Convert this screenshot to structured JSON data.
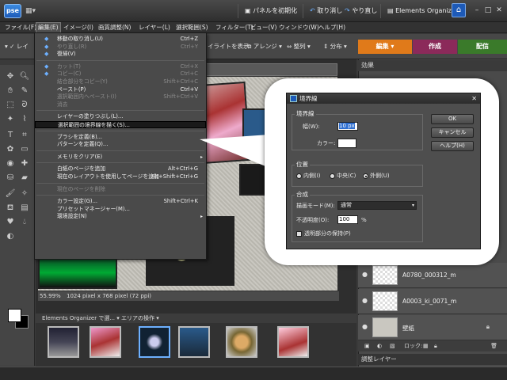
{
  "app": {
    "logo": "pse"
  },
  "titlebar": {
    "reset_panels": "パネルを初期化",
    "undo": "取り消し",
    "redo": "やり直し",
    "organizer": "Elements Organizer"
  },
  "menubar": [
    "ファイル(F)",
    "編集(E)",
    "イメージ(I)",
    "画質調整(N)",
    "レイヤー(L)",
    "選択範囲(S)",
    "フィルター(T)",
    "ビュー(V)",
    "ウィンドウ(W)",
    "ヘルプ(H)"
  ],
  "options": {
    "highlight": "イライトを表示",
    "arrange": "アレンジ",
    "align": "整列",
    "distribute": "分布",
    "layer_label": "レイ"
  },
  "mode_tabs": [
    {
      "label": "編集",
      "color": "#e07a1a"
    },
    {
      "label": "作成",
      "color": "#8b2a5a"
    },
    {
      "label": "配信",
      "color": "#3a7a2a"
    }
  ],
  "edit_menu": {
    "items": [
      {
        "label": "移動の取り消し(U)",
        "shortcut": "Ctrl+Z",
        "disabled": false,
        "icon": true
      },
      {
        "label": "やり直し(R)",
        "shortcut": "Ctrl+Y",
        "disabled": true,
        "icon": true
      },
      {
        "label": "復帰(V)",
        "shortcut": "",
        "disabled": false,
        "icon": true
      },
      {
        "sep": true
      },
      {
        "label": "カット(T)",
        "shortcut": "Ctrl+X",
        "disabled": true,
        "icon": true
      },
      {
        "label": "コピー(C)",
        "shortcut": "Ctrl+C",
        "disabled": true,
        "icon": true
      },
      {
        "label": "結合部分をコピー(Y)",
        "shortcut": "Shift+Ctrl+C",
        "disabled": true
      },
      {
        "label": "ペースト(P)",
        "shortcut": "Ctrl+V",
        "disabled": false
      },
      {
        "label": "選択範囲内へペースト(I)",
        "shortcut": "Shift+Ctrl+V",
        "disabled": true
      },
      {
        "label": "消去",
        "shortcut": "",
        "disabled": true
      },
      {
        "sep": true
      },
      {
        "label": "レイヤーの塗りつぶし(L)...",
        "shortcut": "",
        "disabled": false
      },
      {
        "label": "選択範囲の境界線を描く(S)...",
        "shortcut": "",
        "disabled": false,
        "highlighted": true
      },
      {
        "sep": true
      },
      {
        "label": "ブラシを定義(B)...",
        "shortcut": "",
        "disabled": false
      },
      {
        "label": "パターンを定義(Q)...",
        "shortcut": "",
        "disabled": false
      },
      {
        "sep": true
      },
      {
        "label": "メモリをクリア(E)",
        "shortcut": "",
        "disabled": false,
        "submenu": true
      },
      {
        "sep": true
      },
      {
        "label": "白紙のページを追加",
        "shortcut": "Alt+Ctrl+G",
        "disabled": false
      },
      {
        "label": "現在のレイアウトを使用してページを追加",
        "shortcut": "Alt+Shift+Ctrl+G",
        "disabled": false
      },
      {
        "sep": true
      },
      {
        "label": "現在のページを削除",
        "shortcut": "",
        "disabled": true
      },
      {
        "sep": true
      },
      {
        "label": "カラー設定(G)...",
        "shortcut": "Shift+Ctrl+K",
        "disabled": false
      },
      {
        "label": "プリセットマネージャー(M)...",
        "shortcut": "",
        "disabled": false
      },
      {
        "label": "環境設定(N)",
        "shortcut": "",
        "disabled": false,
        "submenu": true
      }
    ]
  },
  "status": {
    "zoom": "55.99%",
    "size": "1024 pixel x 768 pixel (72 ppi)"
  },
  "photo_bin": {
    "source": "Elements Organizer で選...",
    "actions": "エリアの操作"
  },
  "panels": {
    "effects_title": "効果",
    "layers": [
      {
        "name": "A0780_000312_m"
      },
      {
        "name": "A0003_ki_0071_m"
      },
      {
        "name": "壁紙"
      }
    ],
    "lock_label": "ロック:",
    "adjust_title": "調整レイヤー"
  },
  "dialog": {
    "title": "境界線",
    "stroke_group": "境界線",
    "width_label": "幅(W):",
    "width_value": "10 px",
    "color_label": "カラー:",
    "position_group": "位置",
    "pos_inside": "内側(I)",
    "pos_center": "中央(C)",
    "pos_outside": "外側(U)",
    "blend_group": "合成",
    "mode_label": "描画モード(M):",
    "mode_value": "通常",
    "opacity_label": "不透明度(O):",
    "opacity_value": "100",
    "opacity_unit": "%",
    "preserve_label": "透明部分の保持(P)",
    "ok": "OK",
    "cancel": "キャンセル",
    "help": "ヘルプ(H)"
  }
}
